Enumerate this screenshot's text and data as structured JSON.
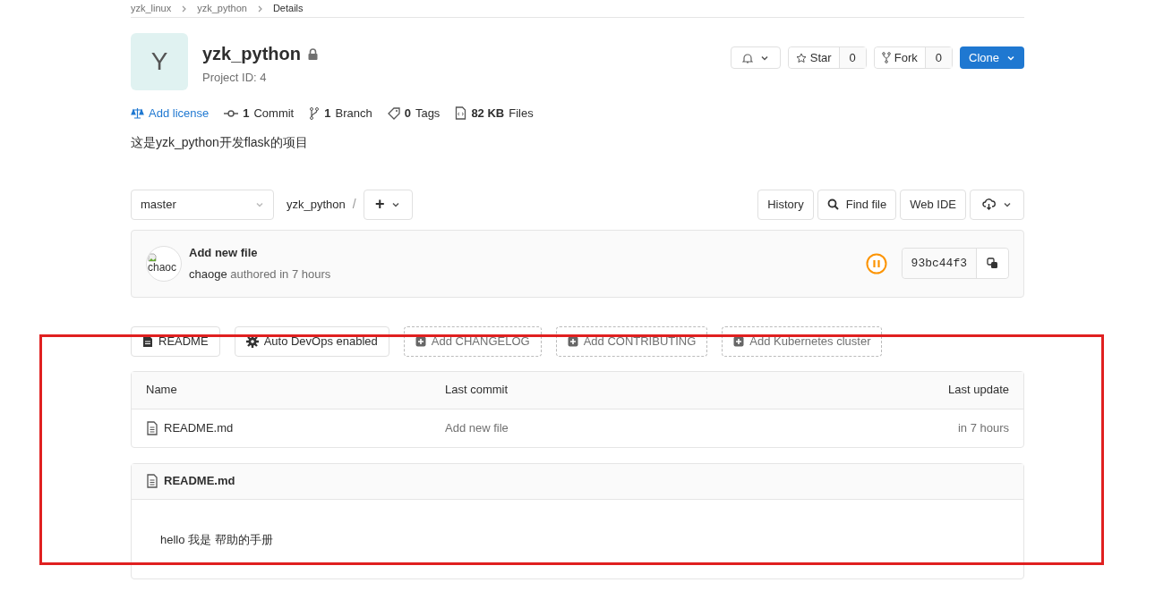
{
  "breadcrumbs": [
    "yzk_linux",
    "yzk_python",
    "Details"
  ],
  "project": {
    "avatar_letter": "Y",
    "name": "yzk_python",
    "private": true,
    "project_id": "Project ID: 4"
  },
  "header_buttons": {
    "star": {
      "label": "Star",
      "count": "0"
    },
    "fork": {
      "label": "Fork",
      "count": "0"
    },
    "clone": "Clone"
  },
  "stats": [
    {
      "kind": "license",
      "label": "Add license"
    },
    {
      "kind": "commit",
      "count": "1",
      "label": "Commit"
    },
    {
      "kind": "branch",
      "count": "1",
      "label": "Branch"
    },
    {
      "kind": "tag",
      "count": "0",
      "label": "Tags"
    },
    {
      "kind": "files",
      "count": "82 KB",
      "label": "Files"
    }
  ],
  "description": "这是yzk_python开发flask的项目",
  "repo_bar": {
    "branch": "master",
    "path": "yzk_python",
    "separator": "/",
    "add": "+",
    "buttons": [
      "History",
      "Find file",
      "Web IDE"
    ]
  },
  "last_commit": {
    "avatar_alt": "chaoc",
    "title": "Add new file",
    "author": "chaoge",
    "meta": "authored in 7 hours",
    "sha": "93bc44f3"
  },
  "quick_links": [
    {
      "kind": "readme",
      "label": "README"
    },
    {
      "kind": "devops",
      "label": "Auto DevOps enabled"
    },
    {
      "kind": "add",
      "label": "Add CHANGELOG"
    },
    {
      "kind": "add",
      "label": "Add CONTRIBUTING"
    },
    {
      "kind": "add",
      "label": "Add Kubernetes cluster"
    }
  ],
  "table": {
    "columns": [
      "Name",
      "Last commit",
      "Last update"
    ],
    "rows": [
      {
        "name": "README.md",
        "last_commit": "Add new file",
        "last_update": "in 7 hours"
      }
    ]
  },
  "readme": {
    "title": "README.md",
    "content": "hello 我是 帮助的手册"
  }
}
